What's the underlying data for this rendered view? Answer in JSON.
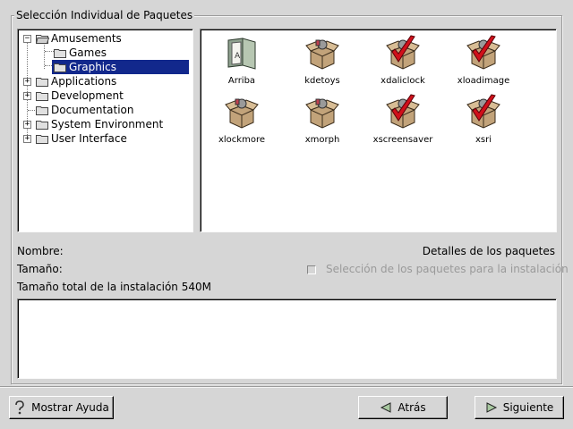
{
  "frame": {
    "title": "Selección Individual de Paquetes"
  },
  "tree": {
    "items": [
      {
        "label": "Amusements",
        "expanded": true,
        "level": 0
      },
      {
        "label": "Games",
        "level": 1
      },
      {
        "label": "Graphics",
        "level": 1,
        "selected": true
      },
      {
        "label": "Applications",
        "expanded": false,
        "level": 0
      },
      {
        "label": "Development",
        "expanded": false,
        "level": 0
      },
      {
        "label": "Documentation",
        "level": 0
      },
      {
        "label": "System Environment",
        "expanded": false,
        "level": 0
      },
      {
        "label": "User Interface",
        "expanded": false,
        "level": 0
      }
    ]
  },
  "packages": [
    {
      "label": "Arriba",
      "icon": "folder-document-icon",
      "selected": false
    },
    {
      "label": "kdetoys",
      "icon": "package-box-icon",
      "selected": false
    },
    {
      "label": "xdaliclock",
      "icon": "package-box-checked-icon",
      "selected": true
    },
    {
      "label": "xloadimage",
      "icon": "package-box-checked-icon",
      "selected": true
    },
    {
      "label": "xlockmore",
      "icon": "package-box-icon",
      "selected": false
    },
    {
      "label": "xmorph",
      "icon": "package-box-icon",
      "selected": false
    },
    {
      "label": "xscreensaver",
      "icon": "package-box-checked-icon",
      "selected": true
    },
    {
      "label": "xsri",
      "icon": "package-box-checked-icon",
      "selected": true
    }
  ],
  "info": {
    "name_label": "Nombre:",
    "size_label": "Tamaño:",
    "total_label": "Tamaño total de la instalación 540M",
    "details_label": "Detalles de los paquetes",
    "select_label": "Selección de los paquetes para la instalación"
  },
  "buttons": {
    "help": "Mostrar Ayuda",
    "back": "Atrás",
    "next": "Siguiente"
  },
  "colors": {
    "selection": "#12288c",
    "check": "#d0101a",
    "background": "#d6d6d6"
  }
}
